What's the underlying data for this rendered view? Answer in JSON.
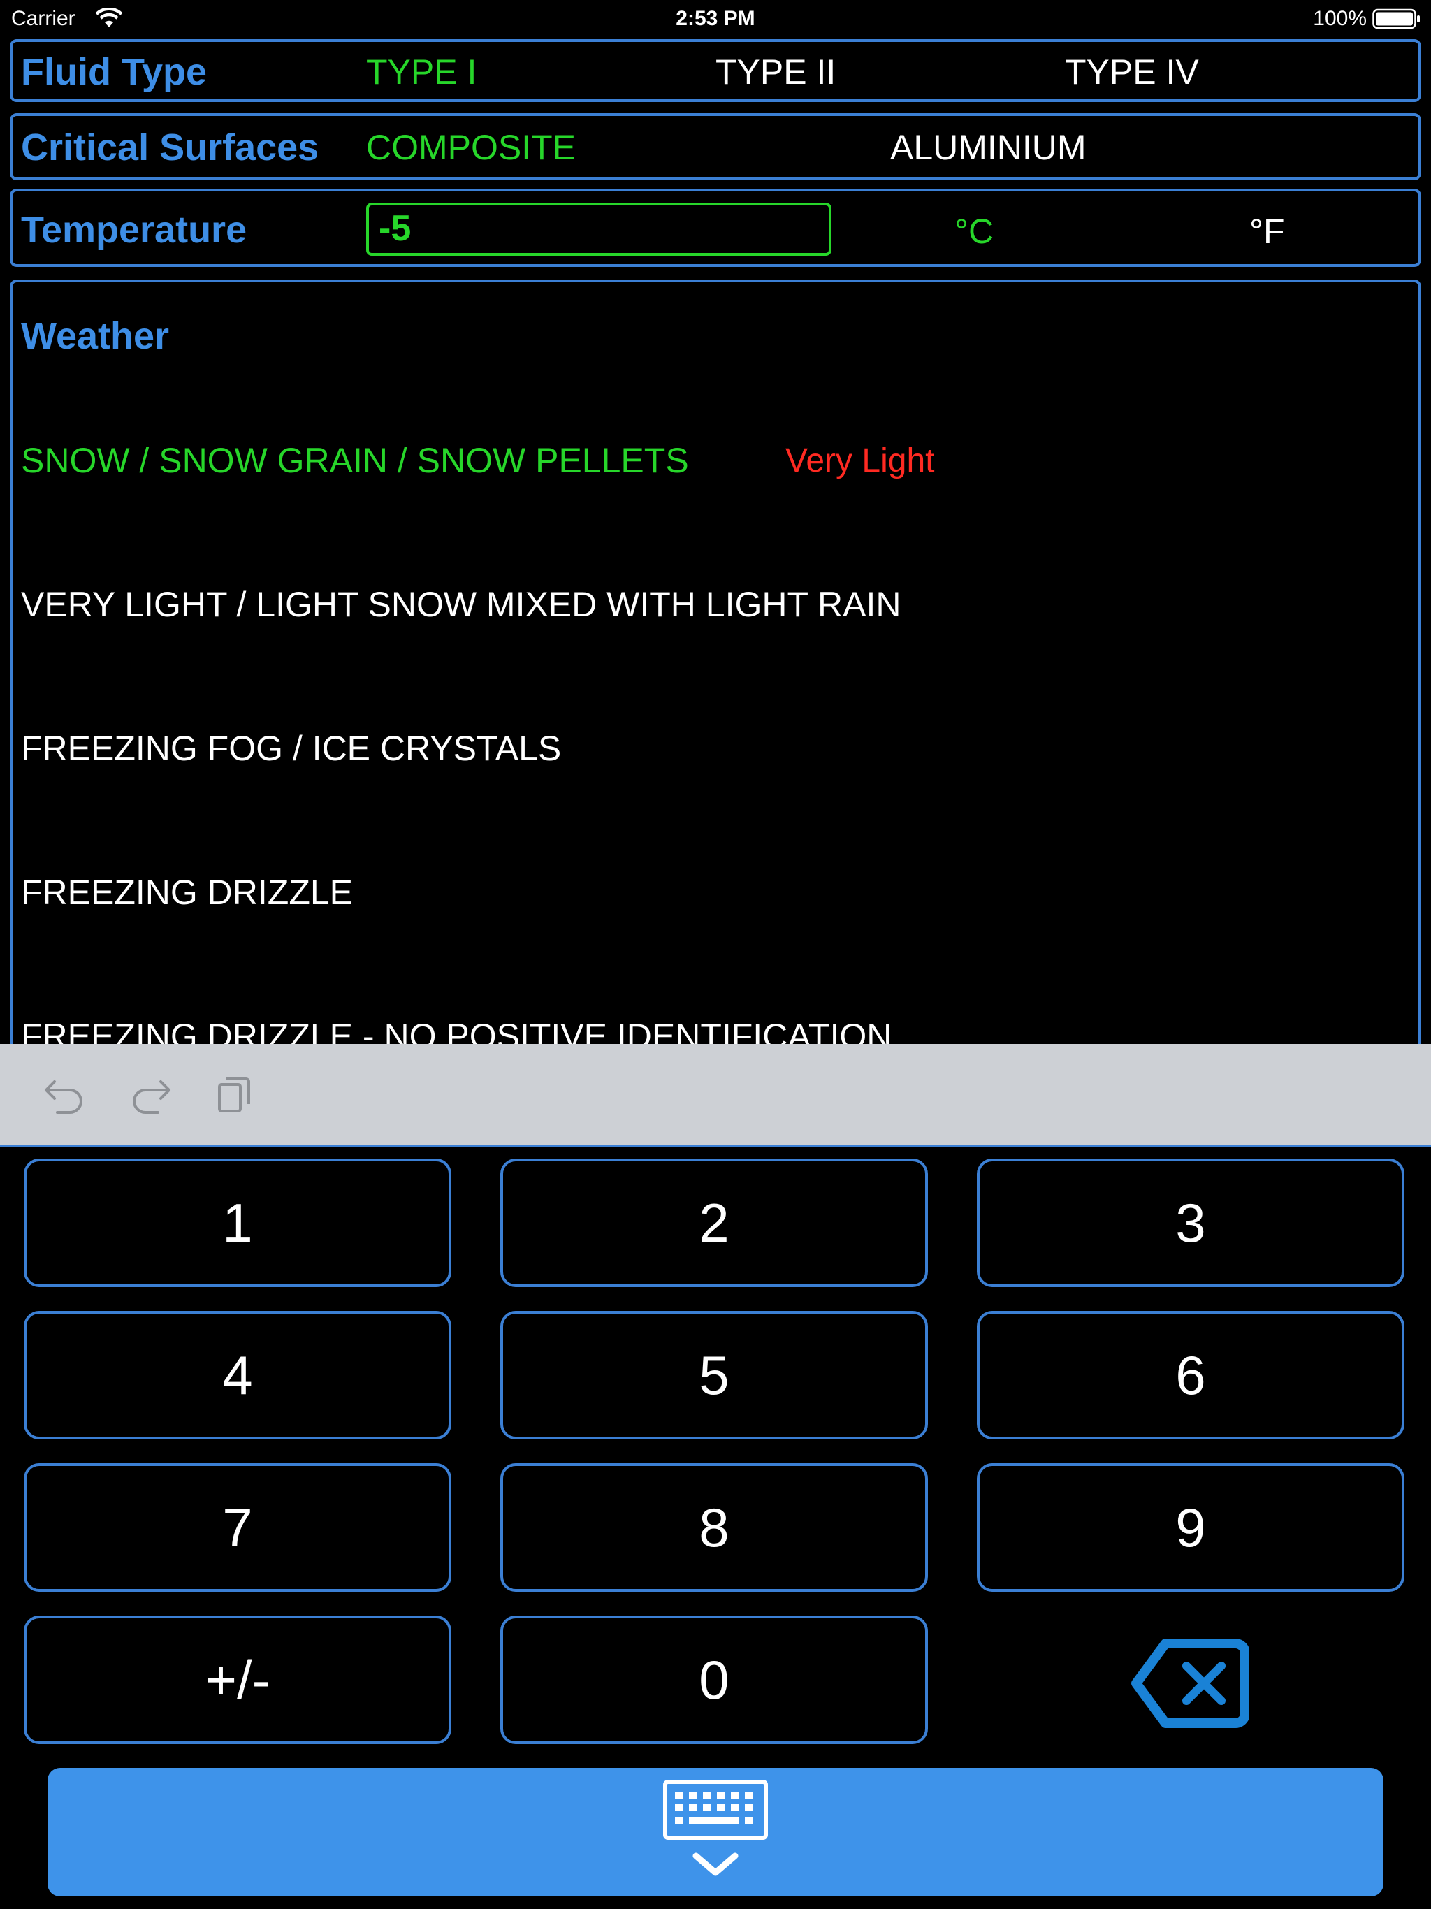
{
  "status_bar": {
    "carrier": "Carrier",
    "time": "2:53 PM",
    "battery": "100%"
  },
  "fluid_type": {
    "label": "Fluid Type",
    "options": [
      "TYPE I",
      "TYPE II",
      "TYPE IV"
    ],
    "selected": "TYPE I"
  },
  "critical_surfaces": {
    "label": "Critical Surfaces",
    "options": [
      "COMPOSITE",
      "ALUMINIUM"
    ],
    "selected": "COMPOSITE"
  },
  "temperature": {
    "label": "Temperature",
    "value": "-5",
    "units": [
      "°C",
      "°F"
    ],
    "selected_unit": "°C"
  },
  "weather": {
    "label": "Weather",
    "items": [
      "SNOW / SNOW GRAIN / SNOW PELLETS",
      "VERY LIGHT / LIGHT SNOW MIXED WITH LIGHT RAIN",
      "FREEZING FOG / ICE CRYSTALS",
      "FREEZING DRIZZLE",
      "FREEZING DRIZZLE - NO POSITIVE IDENTIFICATION"
    ],
    "selected": "SNOW / SNOW GRAIN / SNOW PELLETS",
    "selected_intensity": "Very Light"
  },
  "toolbar": {
    "icons": [
      "undo-icon",
      "redo-icon",
      "paste-icon"
    ]
  },
  "keypad": {
    "keys": [
      "1",
      "2",
      "3",
      "4",
      "5",
      "6",
      "7",
      "8",
      "9",
      "+/-",
      "0"
    ],
    "delete_icon": "delete-icon",
    "dismiss_icon": "keyboard-dismiss-icon"
  },
  "colors": {
    "accent_blue": "#3e8ee6",
    "selected_green": "#27d62a",
    "intensity_red": "#ff2a22",
    "toolbar_gray": "#cdd0d5",
    "dismiss_blue": "#3e93ea"
  }
}
